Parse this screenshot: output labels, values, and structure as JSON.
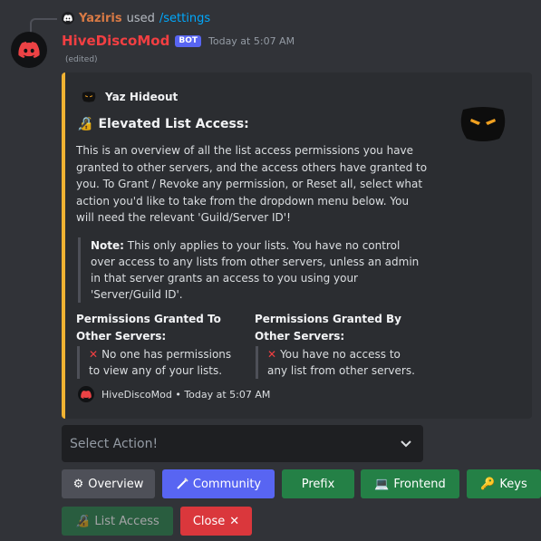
{
  "reply": {
    "user": "Yaziris",
    "verb": "used",
    "command": "/settings"
  },
  "message": {
    "username": "HiveDiscoMod",
    "bot_tag": "BOT",
    "timestamp": "Today at 5:07 AM",
    "edited": "(edited)"
  },
  "embed": {
    "accent_color": "#f0b232",
    "author": "Yaz Hideout",
    "title": "Elevated List Access:",
    "description": "This is an overview of all the list access permissions you have granted to other servers, and the access others have granted to you. To Grant / Revoke any permission, or Reset all, select what action you'd like to take from the dropdown menu below. You will need the relevant 'Guild/Server ID'!",
    "note_label": "Note:",
    "note_text": " This only applies to your lists. You have no control over access to any lists from other servers, unless an admin in that server grants an access to you using your 'Server/Guild ID'.",
    "fields": [
      {
        "name": "Permissions Granted To Other Servers:",
        "value": "No one has permissions to view any of your lists."
      },
      {
        "name": "Permissions Granted By Other Servers:",
        "value": "You have no access to any list from other servers."
      }
    ],
    "footer": "HiveDiscoMod • Today at 5:07 AM"
  },
  "select": {
    "placeholder": "Select Action!"
  },
  "buttons": {
    "overview": "Overview",
    "community": "Community",
    "prefix": "Prefix",
    "frontend": "Frontend",
    "keys": "Keys",
    "list_access": "List Access",
    "close": "Close"
  },
  "colors": {
    "background": "#313338",
    "embed_bg": "#2b2d31",
    "username": "#f23f42",
    "blurple": "#5865f2",
    "green": "#248046",
    "red": "#da373c",
    "gray": "#4e5058"
  }
}
